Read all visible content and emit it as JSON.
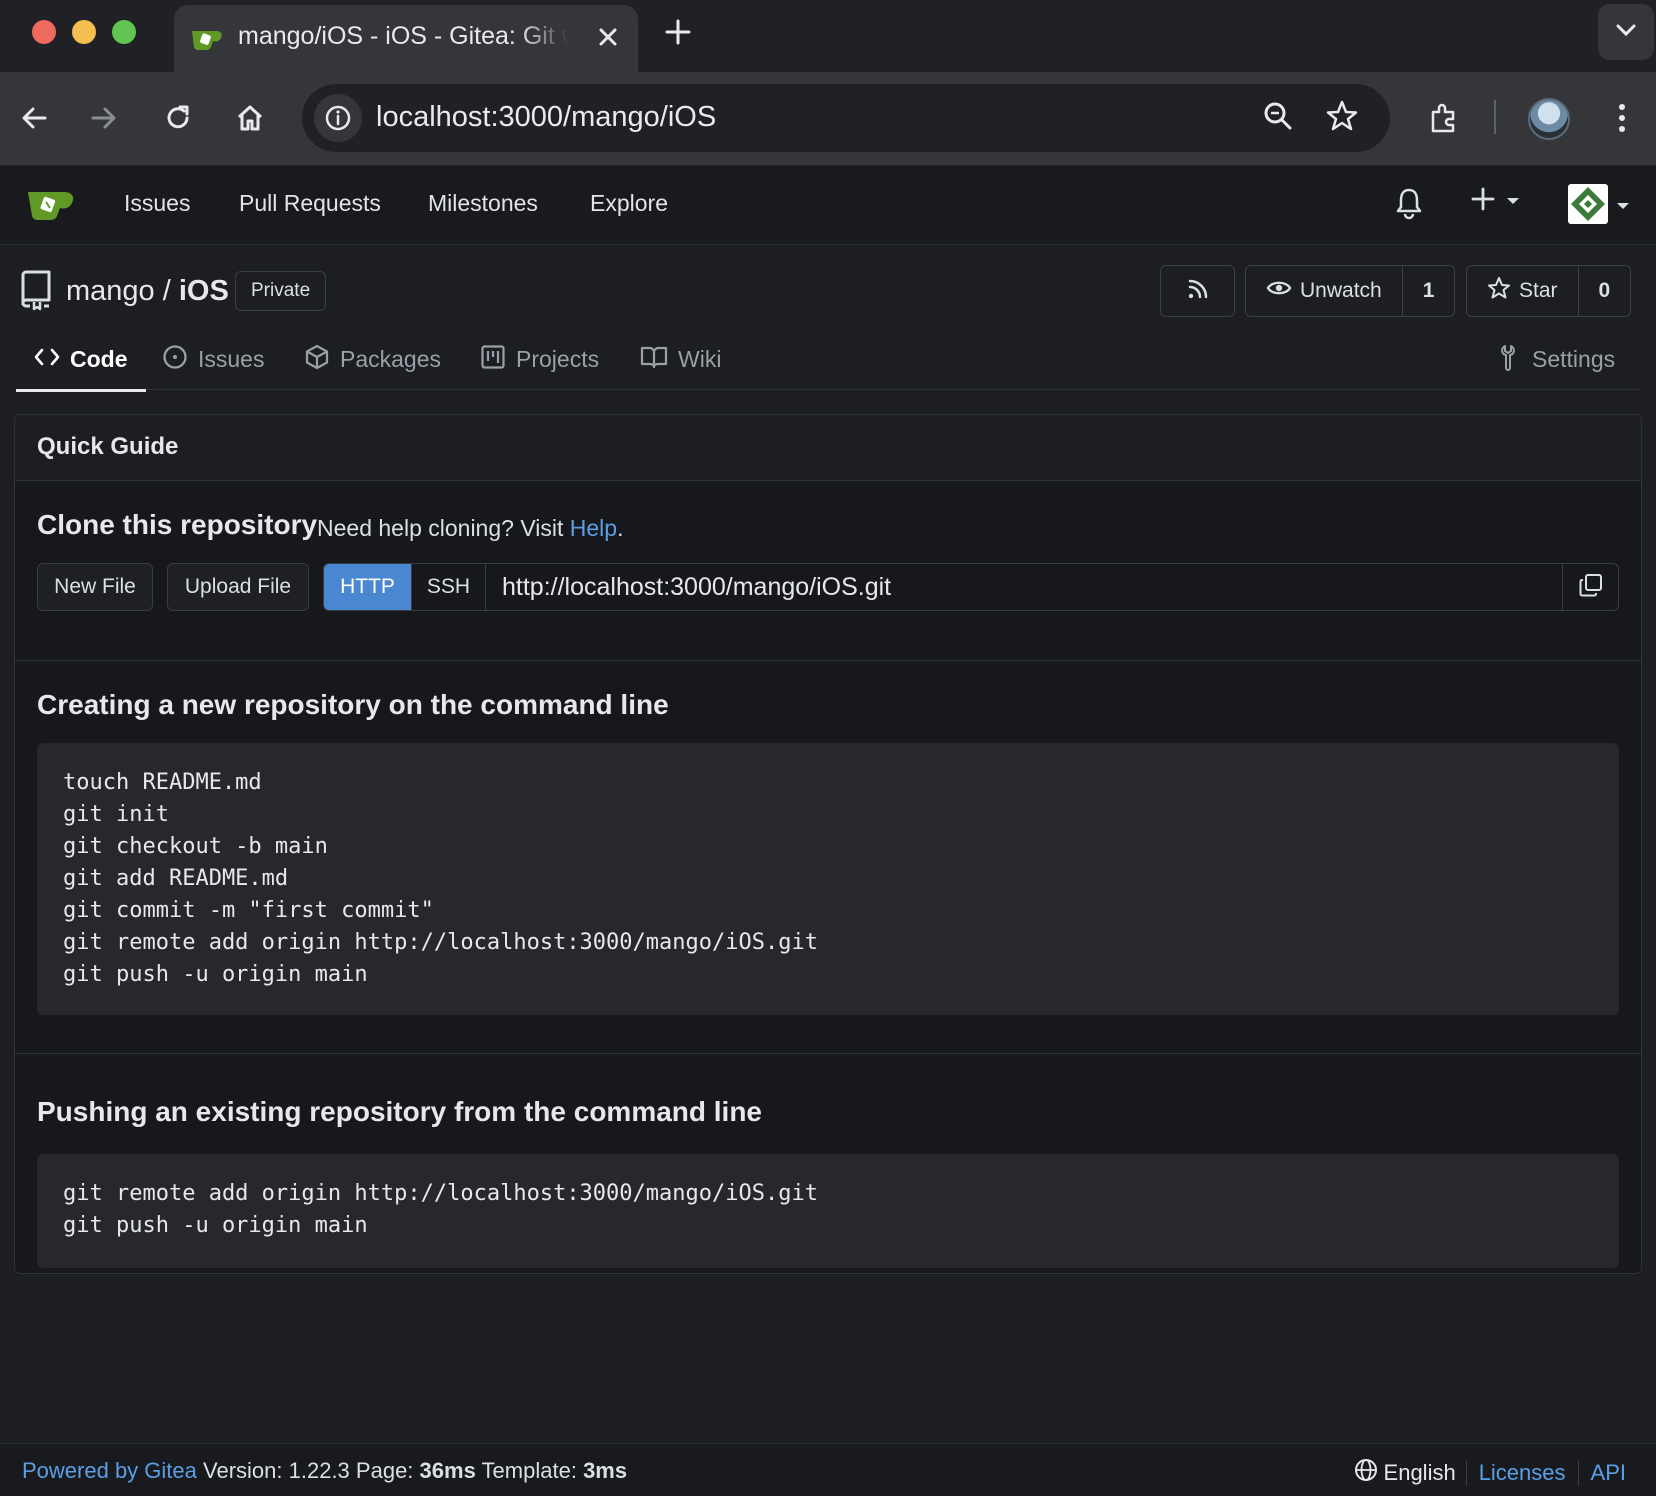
{
  "browser": {
    "tab_title": "mango/iOS - iOS - Gitea: Git with a cup of tea",
    "url": "localhost:3000/mango/iOS"
  },
  "nav": {
    "links": [
      "Issues",
      "Pull Requests",
      "Milestones",
      "Explore"
    ]
  },
  "repo": {
    "owner": "mango",
    "separator": "/",
    "name": "iOS",
    "visibility": "Private",
    "watch_label": "Unwatch",
    "watch_count": "1",
    "star_label": "Star",
    "star_count": "0"
  },
  "tabs": {
    "code": "Code",
    "issues": "Issues",
    "packages": "Packages",
    "projects": "Projects",
    "wiki": "Wiki",
    "settings": "Settings"
  },
  "quick_guide": {
    "header": "Quick Guide",
    "clone_title": "Clone this repository",
    "clone_help_prefix": "Need help cloning? Visit",
    "clone_help_link": "Help",
    "clone_help_suffix": ".",
    "new_file": "New File",
    "upload_file": "Upload File",
    "proto_http": "HTTP",
    "proto_ssh": "SSH",
    "clone_url": "http://localhost:3000/mango/iOS.git",
    "new_repo_title": "Creating a new repository on the command line",
    "new_repo_code": "touch README.md\ngit init\ngit checkout -b main\ngit add README.md\ngit commit -m \"first commit\"\ngit remote add origin http://localhost:3000/mango/iOS.git\ngit push -u origin main",
    "push_title": "Pushing an existing repository from the command line",
    "push_code": "git remote add origin http://localhost:3000/mango/iOS.git\ngit push -u origin main"
  },
  "footer": {
    "powered": "Powered by Gitea",
    "version_label": "Version:",
    "version": "1.22.3",
    "page_label": "Page:",
    "page_time": "36ms",
    "template_label": "Template:",
    "template_time": "3ms",
    "language": "English",
    "licenses": "Licenses",
    "api": "API"
  },
  "colors": {
    "accent_blue": "#4a87d1",
    "link_blue": "#5a9fe6",
    "gitea_green": "#609926"
  },
  "icons": [
    "gitea-logo-icon",
    "close-icon",
    "plus-icon",
    "chevron-down-icon",
    "back-icon",
    "forward-icon",
    "reload-icon",
    "home-icon",
    "info-icon",
    "zoom-icon",
    "star-icon",
    "extensions-icon",
    "kebab-menu-icon",
    "bell-icon",
    "repo-icon",
    "rss-icon",
    "eye-icon",
    "code-icon",
    "issue-icon",
    "package-icon",
    "project-icon",
    "book-icon",
    "tools-icon",
    "copy-icon",
    "globe-icon"
  ]
}
